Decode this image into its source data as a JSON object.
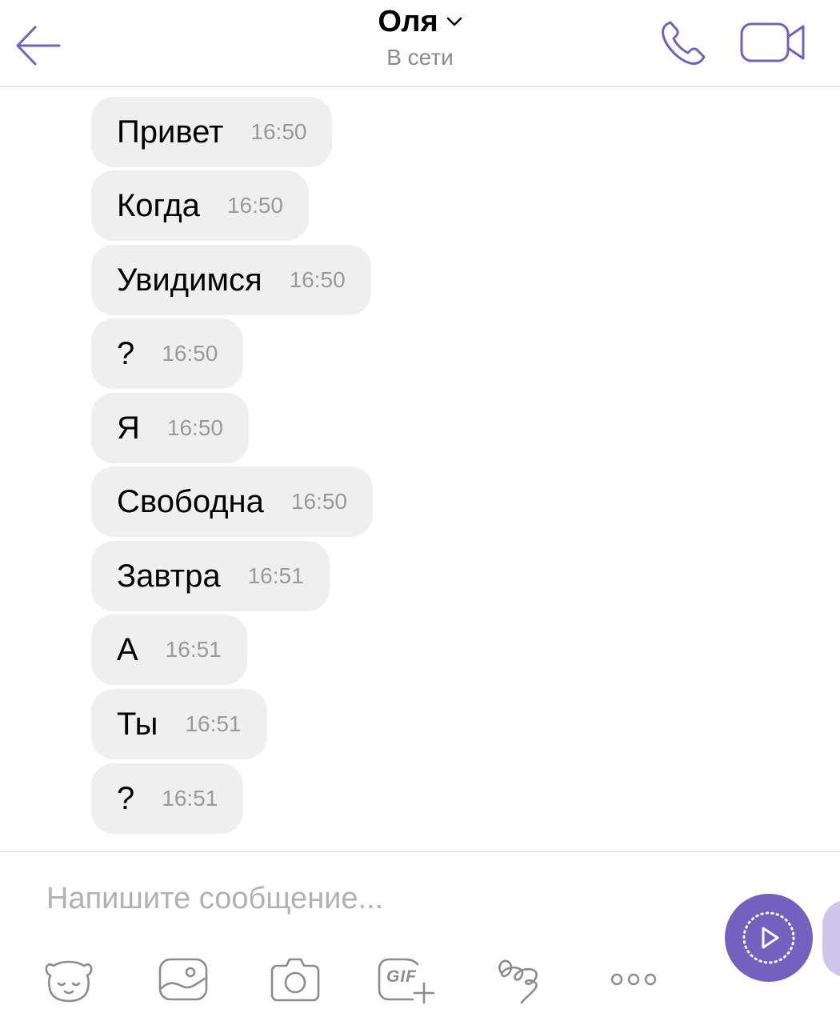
{
  "header": {
    "title": "Оля",
    "status": "В сети"
  },
  "messages": [
    {
      "text": "Привет",
      "time": "16:50"
    },
    {
      "text": "Когда",
      "time": "16:50"
    },
    {
      "text": "Увидимся",
      "time": "16:50"
    },
    {
      "text": "?",
      "time": "16:50"
    },
    {
      "text": "Я",
      "time": "16:50"
    },
    {
      "text": "Свободна",
      "time": "16:50"
    },
    {
      "text": "Завтра",
      "time": "16:51"
    },
    {
      "text": "А",
      "time": "16:51"
    },
    {
      "text": "Ты",
      "time": "16:51"
    },
    {
      "text": "?",
      "time": "16:51"
    }
  ],
  "composer": {
    "placeholder": "Напишите сообщение...",
    "value": "",
    "gif_label": "GIF",
    "tools": [
      "sticker-icon",
      "gallery-icon",
      "camera-icon",
      "gif-icon",
      "doodle-icon",
      "more-icon"
    ]
  },
  "colors": {
    "accent": "#7360bf",
    "bubble": "#efefef",
    "time": "#9a9a9a",
    "status": "#8a8a8a"
  }
}
